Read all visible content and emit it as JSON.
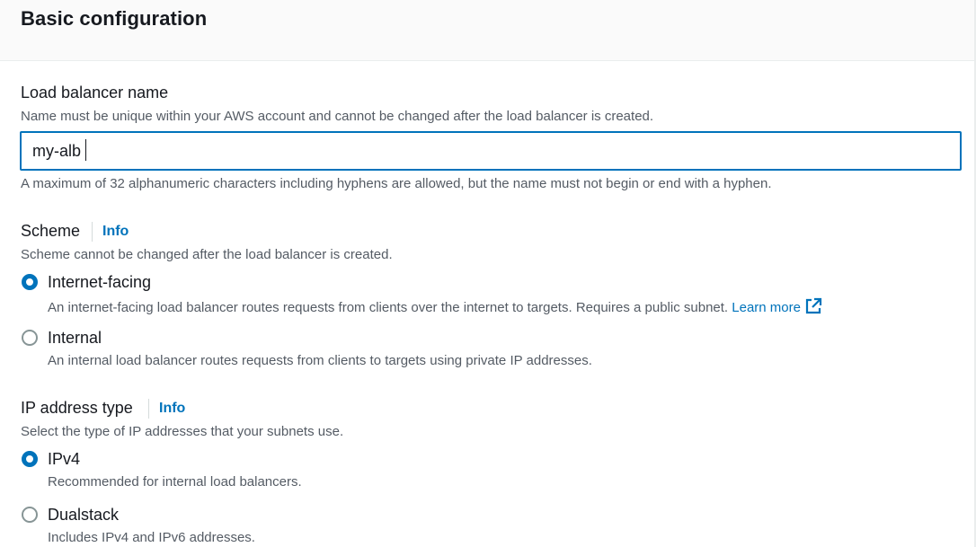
{
  "header": {
    "title": "Basic configuration"
  },
  "name_field": {
    "label": "Load balancer name",
    "description": "Name must be unique within your AWS account and cannot be changed after the load balancer is created.",
    "value": "my-alb",
    "constraint": "A maximum of 32 alphanumeric characters including hyphens are allowed, but the name must not begin or end with a hyphen."
  },
  "scheme": {
    "label": "Scheme",
    "info": "Info",
    "description": "Scheme cannot be changed after the load balancer is created.",
    "options": [
      {
        "label": "Internet-facing",
        "description": "An internet-facing load balancer routes requests from clients over the internet to targets. Requires a public subnet.",
        "link": "Learn more",
        "selected": true
      },
      {
        "label": "Internal",
        "description": "An internal load balancer routes requests from clients to targets using private IP addresses.",
        "selected": false
      }
    ]
  },
  "ip_type": {
    "label": "IP address type",
    "info": "Info",
    "description": "Select the type of IP addresses that your subnets use.",
    "options": [
      {
        "label": "IPv4",
        "description": "Recommended for internal load balancers.",
        "selected": true
      },
      {
        "label": "Dualstack",
        "description": "Includes IPv4 and IPv6 addresses.",
        "selected": false
      }
    ]
  },
  "colors": {
    "accent": "#0073bb",
    "text": "#16191f",
    "secondary_text": "#545b64"
  },
  "icons": {
    "external_link": "external-link-icon"
  }
}
